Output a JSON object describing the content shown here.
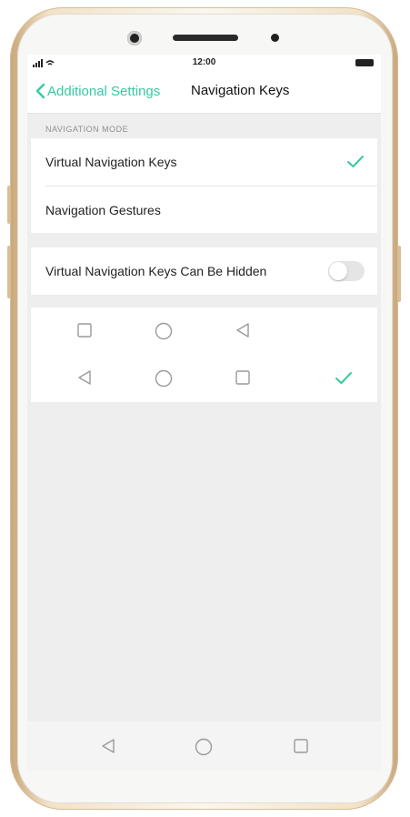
{
  "status_bar": {
    "signal": "all",
    "time": "12:00"
  },
  "nav": {
    "back_label": "Additional Settings",
    "title": "Navigation Keys"
  },
  "navigation_mode": {
    "header": "NAVIGATION MODE",
    "options": [
      {
        "label": "Virtual Navigation Keys",
        "selected": true
      },
      {
        "label": "Navigation Gestures",
        "selected": false
      }
    ]
  },
  "hide_keys": {
    "label": "Virtual Navigation Keys Can Be Hidden",
    "enabled": false
  },
  "key_layouts": [
    {
      "keys": [
        "square-icon",
        "circle-icon",
        "triangle-left-icon"
      ],
      "selected": false
    },
    {
      "keys": [
        "triangle-left-icon",
        "circle-icon",
        "square-icon"
      ],
      "selected": true
    }
  ],
  "bottom_nav": [
    "back-icon",
    "home-icon",
    "recents-icon"
  ],
  "colors": {
    "accent": "#35c9a4",
    "background": "#eeeeee",
    "card": "#ffffff"
  }
}
